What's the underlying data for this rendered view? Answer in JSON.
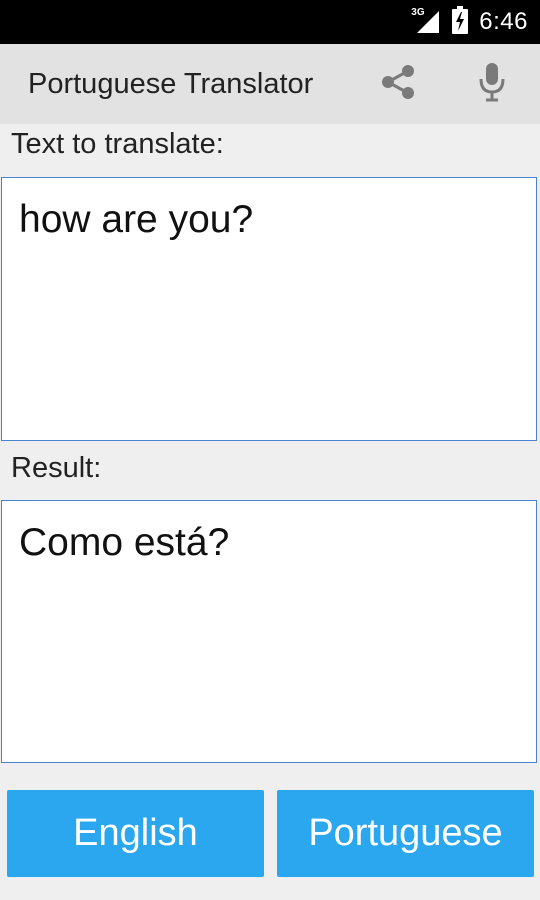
{
  "status_bar": {
    "network_type": "3G",
    "time": "6:46"
  },
  "app_bar": {
    "title": "Portuguese Translator",
    "actions": [
      {
        "icon": "share-icon"
      },
      {
        "icon": "microphone-icon"
      }
    ]
  },
  "input_section": {
    "label": "Text to translate:",
    "value": "how are you?"
  },
  "result_section": {
    "label": "Result:",
    "value": "Como está?"
  },
  "language_buttons": {
    "source": "English",
    "target": "Portuguese"
  },
  "colors": {
    "accent": "#2aa7ef",
    "field_border": "#4a83d4",
    "app_bar": "#e2e2e2",
    "background": "#efefef"
  }
}
